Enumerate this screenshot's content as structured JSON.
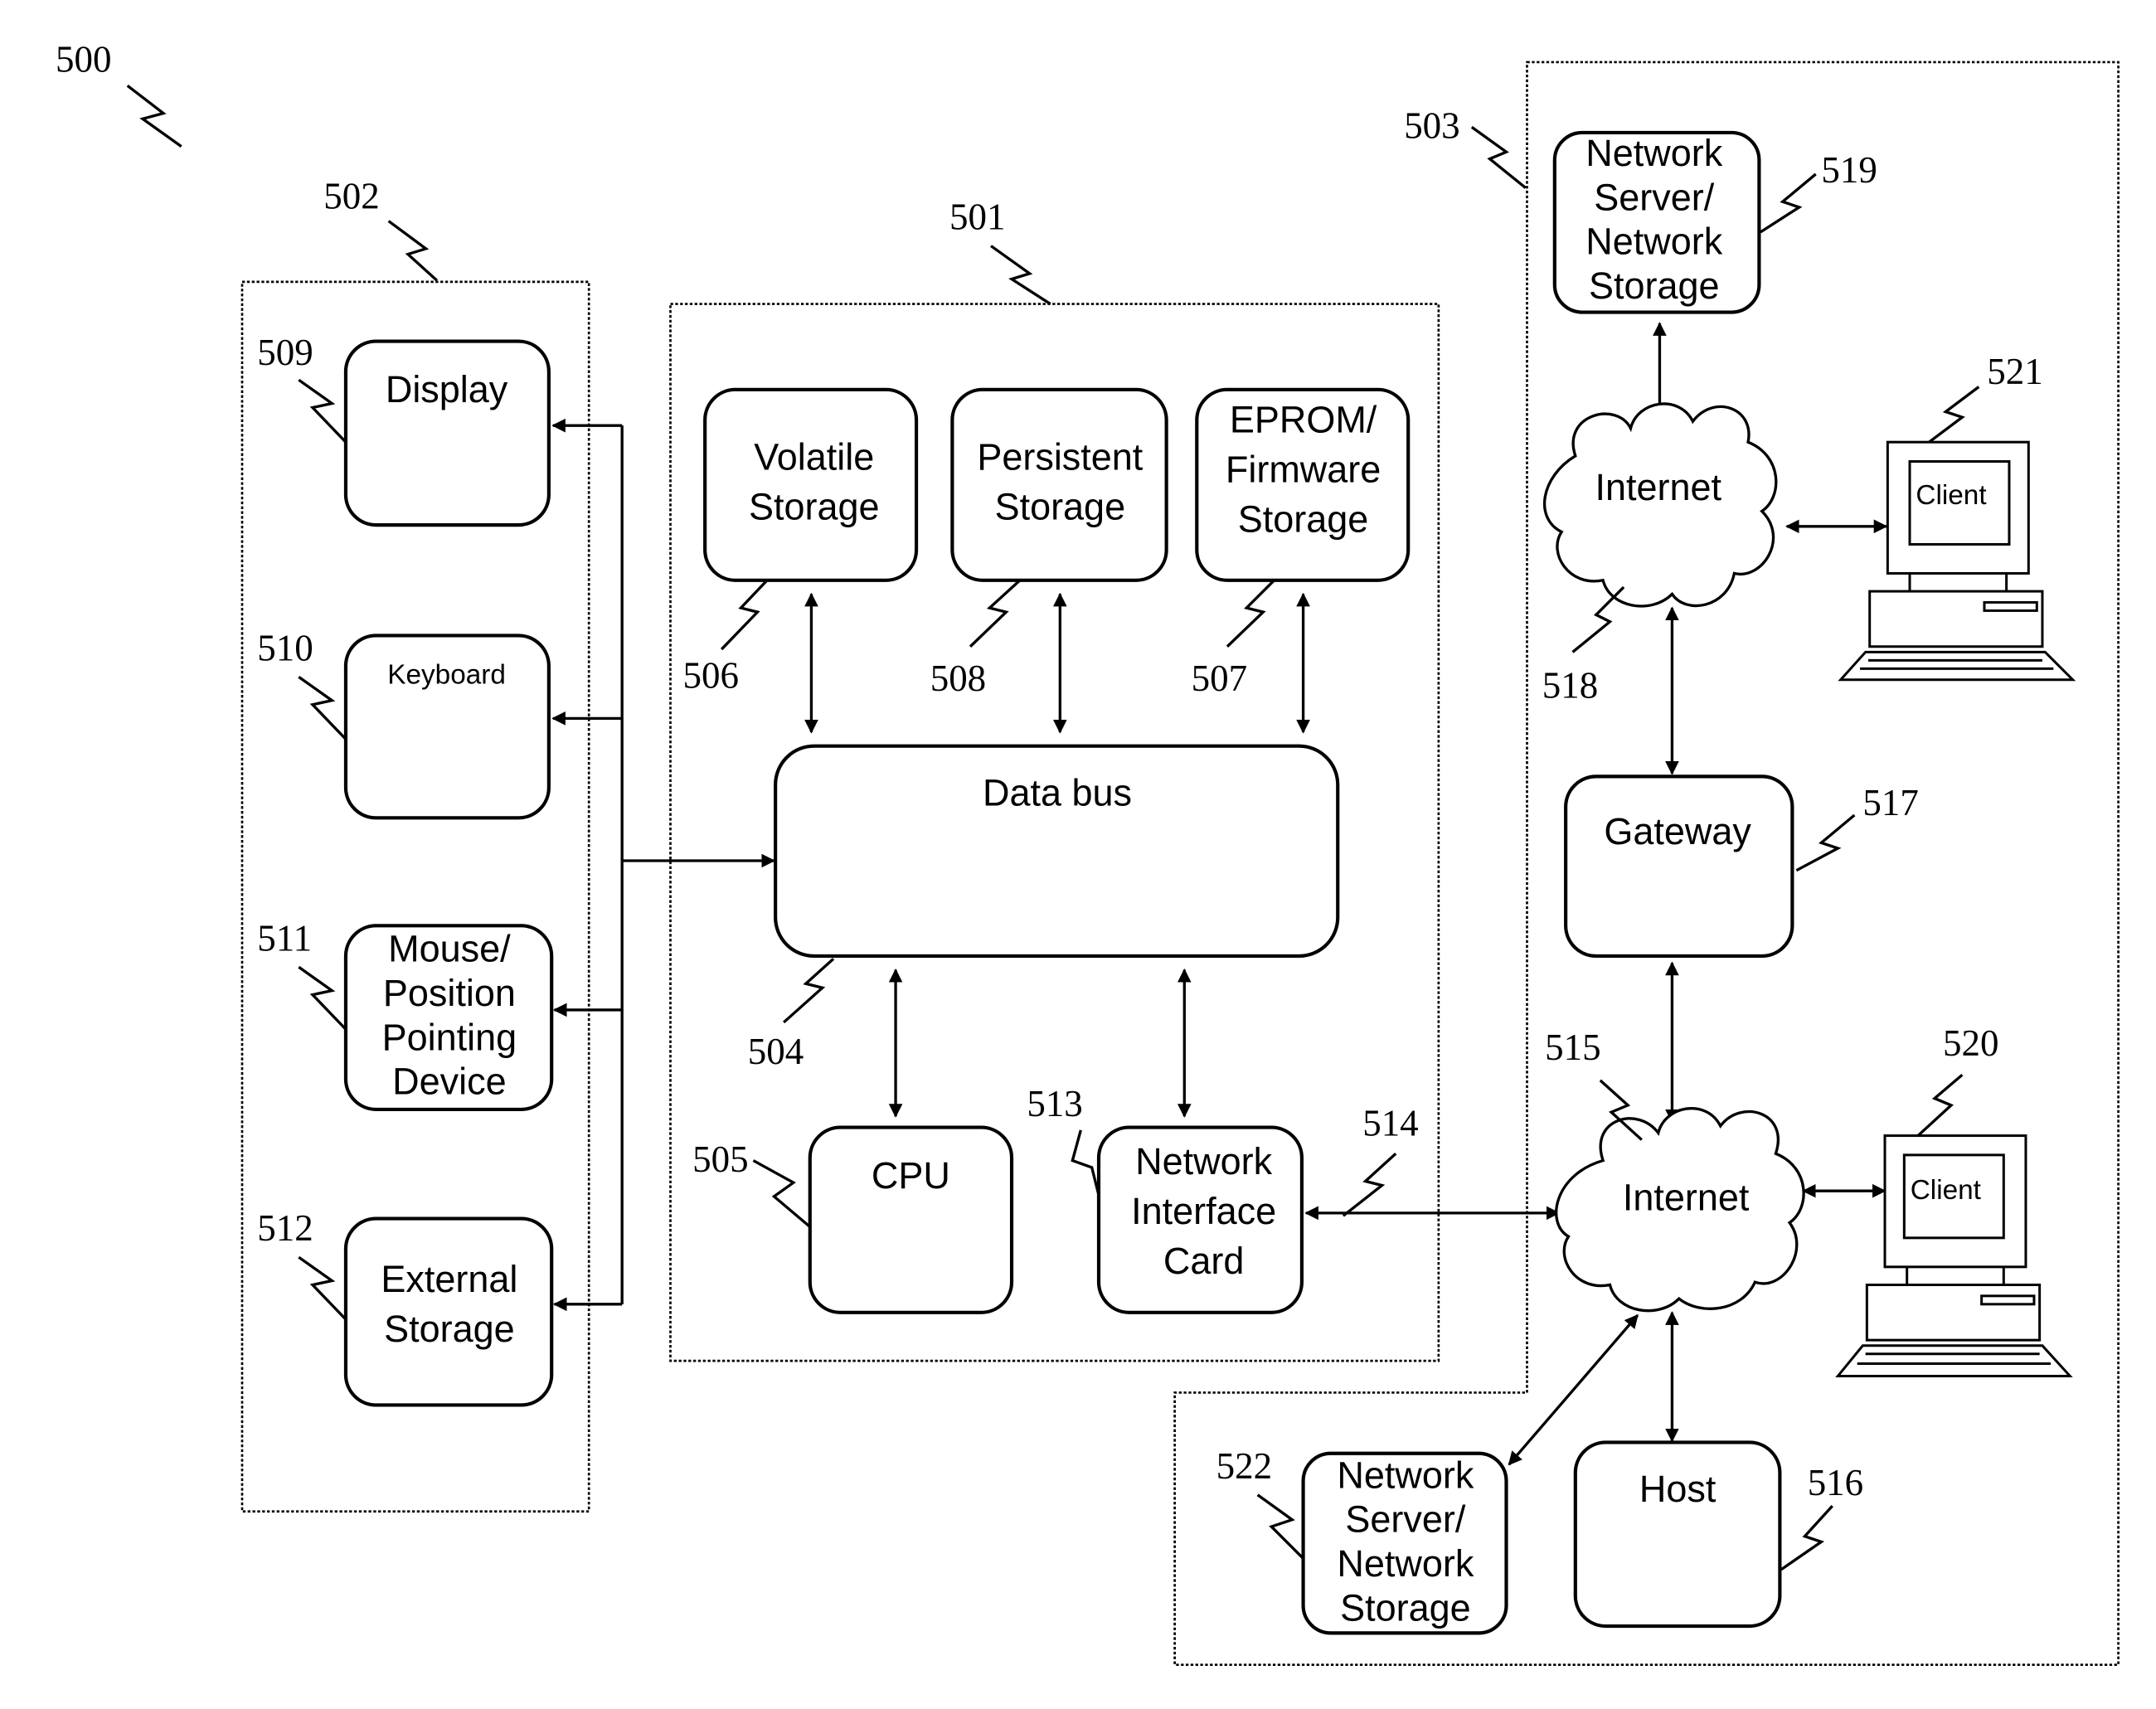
{
  "figure": {
    "ref": "500"
  },
  "groups": {
    "peripherals": {
      "ref": "502"
    },
    "computer": {
      "ref": "501"
    },
    "network": {
      "ref": "503"
    }
  },
  "nodes": {
    "display": {
      "ref": "509",
      "lines": [
        "Display"
      ]
    },
    "keyboard": {
      "ref": "510",
      "lines": [
        "Keyboard"
      ]
    },
    "mouse": {
      "ref": "511",
      "lines": [
        "Mouse/",
        "Position",
        "Pointing",
        "Device"
      ]
    },
    "external_storage": {
      "ref": "512",
      "lines": [
        "External",
        "Storage"
      ]
    },
    "volatile": {
      "ref": "506",
      "lines": [
        "Volatile",
        "Storage"
      ]
    },
    "persistent": {
      "ref": "508",
      "lines": [
        "Persistent",
        "Storage"
      ]
    },
    "eprom": {
      "ref": "507",
      "lines": [
        "EPROM/",
        "Firmware",
        "Storage"
      ]
    },
    "databus": {
      "ref": "504",
      "lines": [
        "Data bus"
      ]
    },
    "cpu": {
      "ref": "505",
      "lines": [
        "CPU"
      ]
    },
    "nic": {
      "ref": "513",
      "lines": [
        "Network",
        "Interface",
        "Card"
      ]
    },
    "link": {
      "ref": "514"
    },
    "server_top": {
      "ref": "519",
      "lines": [
        "Network",
        "Server/",
        "Network",
        "Storage"
      ]
    },
    "internet_top": {
      "ref": "518",
      "lines": [
        "Internet"
      ]
    },
    "client_top": {
      "ref": "521",
      "lines": [
        "Client"
      ]
    },
    "gateway": {
      "ref": "517",
      "lines": [
        "Gateway"
      ]
    },
    "internet_bottom": {
      "ref": "515",
      "lines": [
        "Internet"
      ]
    },
    "client_bottom": {
      "ref": "520",
      "lines": [
        "Client"
      ]
    },
    "server_bottom": {
      "ref": "522",
      "lines": [
        "Network",
        "Server/",
        "Network",
        "Storage"
      ]
    },
    "host": {
      "ref": "516",
      "lines": [
        "Host"
      ]
    }
  }
}
